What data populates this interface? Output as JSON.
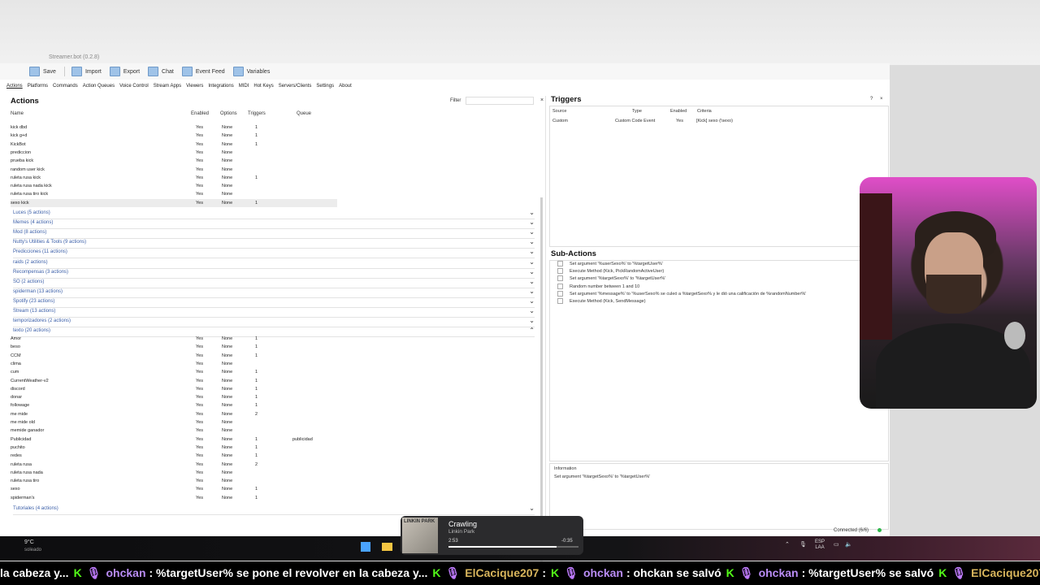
{
  "window": {
    "title": "Streamer.bot (0.2.8)"
  },
  "toolbar": [
    {
      "label": "Save",
      "icon": "save-icon"
    },
    {
      "label": "Import",
      "icon": "import-icon"
    },
    {
      "label": "Export",
      "icon": "export-icon"
    },
    {
      "label": "Chat",
      "icon": "chat-icon"
    },
    {
      "label": "Event Feed",
      "icon": "event-feed-icon"
    },
    {
      "label": "Variables",
      "icon": "variables-icon"
    }
  ],
  "menu": [
    "Actions",
    "Platforms",
    "Commands",
    "Action Queues",
    "Voice Control",
    "Stream Apps",
    "Viewers",
    "Integrations",
    "MIDI",
    "Hot Keys",
    "Servers/Clients",
    "Settings",
    "About"
  ],
  "actions": {
    "title": "Actions",
    "filter_label": "Filter",
    "filter_value": "",
    "clear": "×",
    "columns": {
      "name": "Name",
      "enabled": "Enabled",
      "options": "Options",
      "triggers": "Triggers",
      "queue": "Queue"
    },
    "top_rows": [
      {
        "name": "kick dbd",
        "enabled": "Yes",
        "options": "None",
        "triggers": "1",
        "queue": ""
      },
      {
        "name": "kick g+d",
        "enabled": "Yes",
        "options": "None",
        "triggers": "1",
        "queue": ""
      },
      {
        "name": "KickBot",
        "enabled": "Yes",
        "options": "None",
        "triggers": "1",
        "queue": ""
      },
      {
        "name": "prediccion",
        "enabled": "Yes",
        "options": "None",
        "triggers": "",
        "queue": ""
      },
      {
        "name": "prueba kick",
        "enabled": "Yes",
        "options": "None",
        "triggers": "",
        "queue": ""
      },
      {
        "name": "random user kick",
        "enabled": "Yes",
        "options": "None",
        "triggers": "",
        "queue": ""
      },
      {
        "name": "ruleta rusa kick",
        "enabled": "Yes",
        "options": "None",
        "triggers": "1",
        "queue": ""
      },
      {
        "name": "ruleta rusa nada kick",
        "enabled": "Yes",
        "options": "None",
        "triggers": "",
        "queue": ""
      },
      {
        "name": "ruleta rusa tiro kick",
        "enabled": "Yes",
        "options": "None",
        "triggers": "",
        "queue": ""
      },
      {
        "name": "sexo kick",
        "enabled": "Yes",
        "options": "None",
        "triggers": "1",
        "queue": "",
        "selected": true
      }
    ],
    "groups": [
      {
        "label": "Luces (5 actions)",
        "expanded": false
      },
      {
        "label": "Memes (4 actions)",
        "expanded": false
      },
      {
        "label": "Mod (8 actions)",
        "expanded": false
      },
      {
        "label": "Nutty's Utilities & Tools (9 actions)",
        "expanded": false
      },
      {
        "label": "Predicciones (11 actions)",
        "expanded": false
      },
      {
        "label": "raids (2 actions)",
        "expanded": false
      },
      {
        "label": "Recompensas (3 actions)",
        "expanded": false
      },
      {
        "label": "SO (2 actions)",
        "expanded": false
      },
      {
        "label": "spiderman (13 actions)",
        "expanded": false
      },
      {
        "label": "Spotify (23 actions)",
        "expanded": false
      },
      {
        "label": "Stream (13 actions)",
        "expanded": false
      },
      {
        "label": "temporizadores (2 actions)",
        "expanded": false
      },
      {
        "label": "texto (20 actions)",
        "expanded": true
      }
    ],
    "texto_rows": [
      {
        "name": "Amor",
        "enabled": "Yes",
        "options": "None",
        "triggers": "1",
        "queue": ""
      },
      {
        "name": "beso",
        "enabled": "Yes",
        "options": "None",
        "triggers": "1",
        "queue": ""
      },
      {
        "name": "CCM",
        "enabled": "Yes",
        "options": "None",
        "triggers": "1",
        "queue": ""
      },
      {
        "name": "clima",
        "enabled": "Yes",
        "options": "None",
        "triggers": "",
        "queue": ""
      },
      {
        "name": "cum",
        "enabled": "Yes",
        "options": "None",
        "triggers": "1",
        "queue": ""
      },
      {
        "name": "CurrentWeather-v2",
        "enabled": "Yes",
        "options": "None",
        "triggers": "1",
        "queue": ""
      },
      {
        "name": "discord",
        "enabled": "Yes",
        "options": "None",
        "triggers": "1",
        "queue": ""
      },
      {
        "name": "donar",
        "enabled": "Yes",
        "options": "None",
        "triggers": "1",
        "queue": ""
      },
      {
        "name": "followage",
        "enabled": "Yes",
        "options": "None",
        "triggers": "1",
        "queue": ""
      },
      {
        "name": "me mide",
        "enabled": "Yes",
        "options": "None",
        "triggers": "2",
        "queue": ""
      },
      {
        "name": "me mide old",
        "enabled": "Yes",
        "options": "None",
        "triggers": "",
        "queue": ""
      },
      {
        "name": "memide ganador",
        "enabled": "Yes",
        "options": "None",
        "triggers": "",
        "queue": ""
      },
      {
        "name": "Publicidad",
        "enabled": "Yes",
        "options": "None",
        "triggers": "1",
        "queue": "publicidad"
      },
      {
        "name": "puchito",
        "enabled": "Yes",
        "options": "None",
        "triggers": "1",
        "queue": ""
      },
      {
        "name": "redes",
        "enabled": "Yes",
        "options": "None",
        "triggers": "1",
        "queue": ""
      },
      {
        "name": "ruleta rusa",
        "enabled": "Yes",
        "options": "None",
        "triggers": "2",
        "queue": ""
      },
      {
        "name": "ruleta rusa nada",
        "enabled": "Yes",
        "options": "None",
        "triggers": "",
        "queue": ""
      },
      {
        "name": "ruleta rusa tiro",
        "enabled": "Yes",
        "options": "None",
        "triggers": "",
        "queue": ""
      },
      {
        "name": "sexo",
        "enabled": "Yes",
        "options": "None",
        "triggers": "1",
        "queue": ""
      },
      {
        "name": "spiderman's",
        "enabled": "Yes",
        "options": "None",
        "triggers": "1",
        "queue": ""
      }
    ],
    "bottom_group": {
      "label": "Tutoriales (4 actions)",
      "expanded": false
    }
  },
  "triggers": {
    "title": "Triggers",
    "help": "?",
    "close": "×",
    "columns": {
      "source": "Source",
      "type": "Type",
      "enabled": "Enabled",
      "criteria": "Criteria"
    },
    "rows": [
      {
        "source": "Custom",
        "type": "Custom Code Event",
        "enabled": "Yes",
        "criteria": "[Kick] sexo (!sexo)"
      }
    ]
  },
  "subactions": {
    "title": "Sub-Actions",
    "items": [
      "Set argument '%userSexo%' to '%targetUser%'",
      "Execute Method (Kick, PickRandomActiveUser)",
      "Set argument '%targetSexo%' to '%targetUser%'",
      "Random number between 1 and 10",
      "Set argument '%message%' to '%userSexo% se culeó a %targetSexo% y le dió una calificación de %randomNumber%'",
      "Execute Method (Kick, SendMessage)"
    ]
  },
  "information": {
    "label": "Information",
    "text": "Set argument '%targetSexo%' to '%targetUser%'"
  },
  "status": {
    "text": "Connected (6/6)",
    "color": "#2eb84a"
  },
  "taskbar": {
    "weather_temp": "9°C",
    "weather_desc": "soleado",
    "lang_top": "ESP",
    "lang_bottom": "LAA"
  },
  "now_playing": {
    "title": "Crawling",
    "artist": "Linkin Park",
    "elapsed": "2:53",
    "remaining": "-0:35",
    "progress": 0.83,
    "album_text": "LINKIN PARK"
  },
  "ticker": {
    "segments": [
      {
        "kind": "text",
        "text": "la cabeza y..."
      },
      {
        "kind": "user",
        "text": "ohckan"
      },
      {
        "kind": "text",
        "text": ": %targetUser% se pone el revolver en la cabeza y..."
      },
      {
        "kind": "user2",
        "text": "ElCacique207"
      },
      {
        "kind": "text",
        "text": ":"
      },
      {
        "kind": "user",
        "text": "ohckan"
      },
      {
        "kind": "text",
        "text": ": ohckan se salvó"
      },
      {
        "kind": "user",
        "text": "ohckan"
      },
      {
        "kind": "text",
        "text": ": %targetUser% se salvó"
      },
      {
        "kind": "user2",
        "text": "ElCacique207"
      },
      {
        "kind": "text",
        "text": ":"
      }
    ]
  }
}
